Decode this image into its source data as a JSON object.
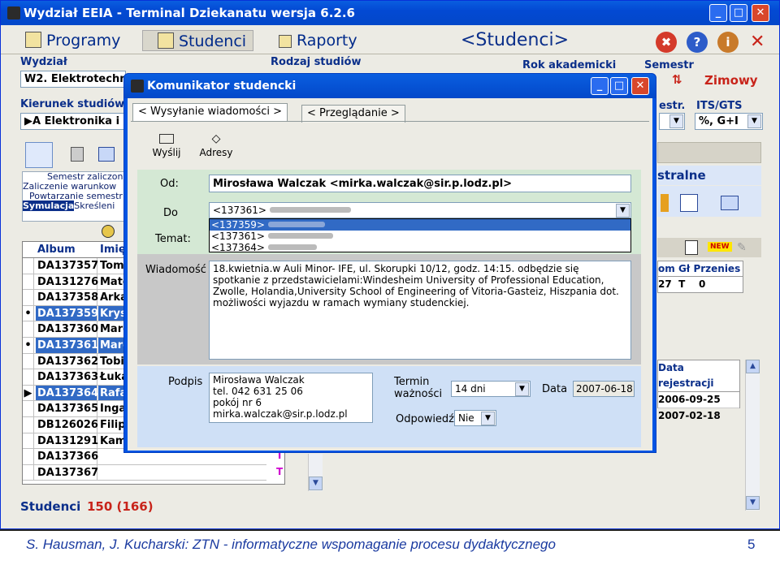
{
  "window": {
    "title": "Wydział EEIA - Terminal Dziekanatu  wersja 6.2.6",
    "min": "_",
    "max": "□",
    "close": "✕"
  },
  "menu": {
    "programy": "Programy",
    "studenci": "Studenci",
    "raporty": "Raporty",
    "current": "<Studenci>",
    "icons": [
      "stop-icon",
      "help-icon",
      "info-icon",
      "close-icon"
    ]
  },
  "filters": {
    "wydzial_label": "Wydział",
    "wydzial_value": "W2. Elektrotechnik",
    "rodzaj_label": "Rodzaj studiów",
    "rok_label": "Rok akademicki",
    "semestr_label": "Semestr",
    "semestr_value": "Zimowy",
    "kierunek_label": "Kierunek studiów",
    "kierunek_value": "A Elektronika i",
    "estr_label": "estr.",
    "estr_value": "",
    "its_label": "ITS/GTS",
    "its_value": "%, G+I"
  },
  "side_panel": {
    "items": [
      "Semestr zaliczon",
      "Zaliczenie warunkow",
      "Powtarzanie semestr",
      "Symulacja",
      "Skreśleni"
    ]
  },
  "grid": {
    "headers": [
      "Album",
      "Imię"
    ],
    "rows": [
      {
        "marker": "",
        "album": "DA137357",
        "name": "Tom"
      },
      {
        "marker": "",
        "album": "DA131276",
        "name": "Mate"
      },
      {
        "marker": "",
        "album": "DA137358",
        "name": "Arka"
      },
      {
        "marker": "•",
        "album": "DA137359",
        "name": "Krysl"
      },
      {
        "marker": "",
        "album": "DA137360",
        "name": "Marc"
      },
      {
        "marker": "•",
        "album": "DA137361",
        "name": "Marc"
      },
      {
        "marker": "",
        "album": "DA137362",
        "name": "Tobi"
      },
      {
        "marker": "",
        "album": "DA137363",
        "name": "Łuka"
      },
      {
        "marker": "▶",
        "album": "DA137364",
        "name": "Rafa"
      },
      {
        "marker": "",
        "album": "DA137365",
        "name": "Inga"
      },
      {
        "marker": "",
        "album": "DB126026",
        "name": "Filip"
      },
      {
        "marker": "",
        "album": "DA131291",
        "name": "Kami"
      },
      {
        "marker": "",
        "album": "DA137366",
        "name": ""
      },
      {
        "marker": "",
        "album": "DA137367",
        "name": ""
      }
    ],
    "t_col": [
      "T",
      "T"
    ]
  },
  "right_panel": {
    "title": "stralne",
    "new_badge": "NEW",
    "headers": [
      "om",
      "Gł",
      "Przenies"
    ],
    "row": [
      "27",
      "T",
      "0"
    ],
    "reg_header": "Data rejestracji",
    "reg_dates": [
      "2006-09-25",
      "2007-02-18"
    ]
  },
  "status": {
    "label": "Studenci",
    "count": "150 (166)"
  },
  "dialog": {
    "title": "Komunikator studencki",
    "tabs": [
      "< Wysyłanie wiadomości >",
      "< Przeglądanie >"
    ],
    "send_label": "Wyślij",
    "addr_label": "Adresy",
    "od_label": "Od:",
    "od_value": "Mirosława Walczak <mirka.walczak@sir.p.lodz.pl>",
    "do_label": "Do",
    "do_value": "<137361>",
    "do_options": [
      "<137359>",
      "<137361>",
      "<137364>"
    ],
    "temat_label": "Temat:",
    "wiadomosc_label": "Wiadomość",
    "message": "18.kwietnia.w Auli Minor- IFE, ul. Skorupki 10/12, godz. 14:15. odbędzie się spotkanie z przedstawicielami:Windesheim University of Professional Education, Zwolle, Holandia,University School of Engineering of Vitoria-Gasteiz, Hiszpania dot. możliwości wyjazdu w ramach wymiany studenckiej.",
    "podpis_label": "Podpis",
    "signature": [
      "Mirosława Walczak",
      "tel. 042 631 25 06",
      "pokój nr 6",
      "mirka.walczak@sir.p.lodz.pl"
    ],
    "termin_label": "Termin\nważności",
    "termin_value": "14 dni",
    "data_label": "Data",
    "data_value": "2007-06-18",
    "odp_label": "Odpowiedź",
    "odp_value": "Nie"
  },
  "footer": {
    "citation": "S. Hausman, J. Kucharski: ZTN - informatyczne wspomaganie procesu dydaktycznego",
    "page": "5"
  }
}
